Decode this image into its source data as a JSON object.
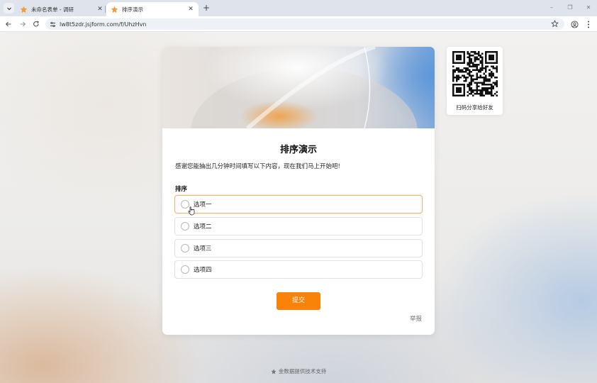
{
  "browser": {
    "tabs": [
      {
        "title": "未命名表单 - 调研",
        "active": false
      },
      {
        "title": "排序演示",
        "active": true
      }
    ],
    "url": "lw8t5zdr.jsjform.com/f/UhzHvn",
    "new_tab": "+",
    "window_controls": [
      "–",
      "❐",
      "✕"
    ]
  },
  "form": {
    "title": "排序演示",
    "description": "感谢您能抽出几分钟时间填写以下内容，现在我们马上开始吧!",
    "question": {
      "label": "排序",
      "options": [
        "选项一",
        "选项二",
        "选项三",
        "选项四"
      ]
    },
    "submit_label": "提交",
    "report_label": "举报"
  },
  "share": {
    "caption": "扫码分享给好友"
  },
  "footer": {
    "text": "金数据提供技术支持"
  },
  "colors": {
    "accent": "#f98208",
    "hover_border": "#f4b26a"
  },
  "icons": [
    "tab-menu-icon",
    "favicon-icon",
    "close-icon",
    "back-icon",
    "forward-icon",
    "reload-icon",
    "site-info-icon",
    "star-icon",
    "profile-icon",
    "more-icon",
    "qr-code-icon",
    "cursor-icon"
  ]
}
